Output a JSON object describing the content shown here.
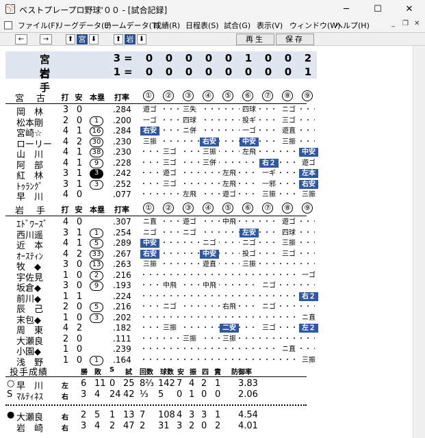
{
  "window": {
    "title": "ベストプレープロ野球'００ - [試合記録]",
    "minimize": "─",
    "maximize": "☐",
    "close": "✕"
  },
  "menu": [
    "ファイル(F)",
    "リーグデータ(L)",
    "チームデータ(T)",
    "成績(R)",
    "日程表(S)",
    "試合(G)",
    "表示(V)",
    "ウィンドウ(W)",
    "ヘルプ(H)"
  ],
  "mdi": {
    "min": "_",
    "restore": "❐",
    "close": "✕"
  },
  "toolbar": {
    "prev": "←",
    "next": "→",
    "team1_up": "⬆",
    "team1": "宮",
    "team1_down": "⬇",
    "team2_up": "⬆",
    "team2": "岩",
    "team2_down": "⬇",
    "replay": "再生",
    "save": "保存"
  },
  "scoreboard": [
    {
      "team": "宮古",
      "total": "3",
      "eq": "=",
      "innings": [
        "0",
        "0",
        "0",
        "0",
        "0",
        "1",
        "0",
        "0",
        "2"
      ]
    },
    {
      "team": "岩手",
      "total": "1",
      "eq": "=",
      "innings": [
        "0",
        "0",
        "0",
        "0",
        "0",
        "0",
        "0",
        "0",
        "1"
      ]
    }
  ],
  "headers": {
    "ab": "打",
    "hit": "安",
    "hr": "本塁",
    "avg": "打率",
    "innings": [
      "①",
      "②",
      "③",
      "④",
      "⑤",
      "⑥",
      "⑦",
      "⑧",
      "⑨"
    ]
  },
  "team1": {
    "name": "宮古",
    "players": [
      {
        "name": "岡　林",
        "ab": "3",
        "h": "0",
        "hr": "",
        "hrs": "",
        "avg": ".284",
        "pa": [
          {
            "i": 0,
            "t": "遊ゴ"
          },
          {
            "i": 2,
            "t": "三失"
          },
          {
            "i": 5,
            "t": "四球"
          },
          {
            "i": 7,
            "t": "ニゴ"
          }
        ]
      },
      {
        "name": "松本剛",
        "ab": "2",
        "h": "0",
        "hr": "1",
        "hrs": "ring",
        "avg": ".200",
        "pa": [
          {
            "i": 0,
            "t": "一ゴ"
          },
          {
            "i": 2,
            "t": "四球"
          },
          {
            "i": 5,
            "t": "投ギ"
          },
          {
            "i": 7,
            "t": "三ゴ"
          }
        ]
      },
      {
        "name": "宮崎☆",
        "ab": "4",
        "h": "1",
        "hr": "16",
        "hrs": "ring",
        "avg": ".284",
        "pa": [
          {
            "i": 0,
            "t": "右安",
            "hit": true
          },
          {
            "i": 2,
            "t": "ニ併"
          },
          {
            "i": 5,
            "t": "一ゴ"
          },
          {
            "i": 7,
            "t": "遊直"
          }
        ]
      },
      {
        "name": "ローリー",
        "ab": "4",
        "h": "2",
        "hr": "30",
        "hrs": "ring",
        "avg": ".230",
        "pa": [
          {
            "i": 0,
            "t": "三振"
          },
          {
            "i": 3,
            "t": "右安",
            "hit": true
          },
          {
            "i": 5,
            "t": "中安",
            "hit": true
          },
          {
            "i": 7,
            "t": "三振"
          }
        ]
      },
      {
        "name": "山　川",
        "ab": "4",
        "h": "1",
        "hr": "38",
        "hrs": "ring",
        "avg": ".230",
        "pa": [
          {
            "i": 1,
            "t": "三ゴ"
          },
          {
            "i": 3,
            "t": "三振"
          },
          {
            "i": 5,
            "t": "左飛"
          },
          {
            "i": 8,
            "t": "中安",
            "hit": true
          }
        ]
      },
      {
        "name": "阿　部",
        "ab": "4",
        "h": "1",
        "hr": "9",
        "hrs": "ring",
        "avg": ".228",
        "pa": [
          {
            "i": 1,
            "t": "三ゴ"
          },
          {
            "i": 3,
            "t": "三併"
          },
          {
            "i": 6,
            "t": "右２",
            "hit": true
          },
          {
            "i": 8,
            "t": "遊ゴ"
          }
        ]
      },
      {
        "name": "紅　林",
        "ab": "3",
        "h": "1",
        "hr": "3",
        "hrs": "fill",
        "avg": ".242",
        "pa": [
          {
            "i": 1,
            "t": "遊ゴ"
          },
          {
            "i": 4,
            "t": "左飛"
          },
          {
            "i": 6,
            "t": "一ギ"
          },
          {
            "i": 8,
            "t": "左本",
            "hit": true
          }
        ]
      },
      {
        "name": "ﾄｩﾗﾝｸﾞ",
        "ab": "3",
        "h": "1",
        "hr": "3",
        "hrs": "ring",
        "avg": ".252",
        "pa": [
          {
            "i": 1,
            "t": "三ゴ"
          },
          {
            "i": 4,
            "t": "左飛"
          },
          {
            "i": 6,
            "t": "一邪"
          },
          {
            "i": 8,
            "t": "右安",
            "hit": true
          }
        ]
      },
      {
        "name": "早　川",
        "ab": "4",
        "h": "0",
        "hr": "",
        "hrs": "",
        "avg": ".077",
        "pa": [
          {
            "i": 2,
            "t": "左飛"
          },
          {
            "i": 4,
            "t": "遊ゴ"
          },
          {
            "i": 6,
            "t": "三振"
          },
          {
            "i": 8,
            "t": "三振"
          }
        ]
      }
    ]
  },
  "team2": {
    "name": "岩手",
    "players": [
      {
        "name": "ｴﾄﾞﾜｰｽﾞ",
        "ab": "4",
        "h": "0",
        "hr": "",
        "hrs": "",
        "avg": ".307",
        "pa": [
          {
            "i": 0,
            "t": "ニ直"
          },
          {
            "i": 2,
            "t": "遊ゴ"
          },
          {
            "i": 4,
            "t": "中飛"
          },
          {
            "i": 7,
            "t": "遊ゴ"
          }
        ]
      },
      {
        "name": "西川遥",
        "ab": "3",
        "h": "1",
        "hr": "1",
        "hrs": "ring",
        "avg": ".254",
        "pa": [
          {
            "i": 0,
            "t": "ニゴ"
          },
          {
            "i": 2,
            "t": "ニゴ"
          },
          {
            "i": 5,
            "t": "左安",
            "hit": true
          },
          {
            "i": 7,
            "t": "四球"
          }
        ]
      },
      {
        "name": "近　本",
        "ab": "4",
        "h": "1",
        "hr": "5",
        "hrs": "ring",
        "avg": ".289",
        "pa": [
          {
            "i": 0,
            "t": "中安",
            "hit": true
          },
          {
            "i": 3,
            "t": "ニゴ"
          },
          {
            "i": 5,
            "t": "ニゴ"
          },
          {
            "i": 7,
            "t": "三振"
          }
        ]
      },
      {
        "name": "ｵｰｽﾃｨﾝ",
        "ab": "4",
        "h": "2",
        "hr": "33",
        "hrs": "ring",
        "avg": ".267",
        "pa": [
          {
            "i": 0,
            "t": "右安",
            "hit": true
          },
          {
            "i": 3,
            "t": "中安",
            "hit": true
          },
          {
            "i": 5,
            "t": "投ゴ"
          },
          {
            "i": 7,
            "t": "三ゴ"
          }
        ]
      },
      {
        "name": "牧　◆",
        "ab": "3",
        "h": "0",
        "hr": "13",
        "hrs": "ring",
        "avg": ".263",
        "pa": [
          {
            "i": 0,
            "t": "三振"
          },
          {
            "i": 3,
            "t": "遊直"
          },
          {
            "i": 5,
            "t": "三振"
          }
        ]
      },
      {
        "name": "宇佐見",
        "ab": "1",
        "h": "0",
        "hr": "2",
        "hrs": "ring",
        "avg": ".216",
        "pa": [
          {
            "i": 8,
            "t": "一ゴ"
          }
        ]
      },
      {
        "name": "坂倉◆",
        "ab": "3",
        "h": "0",
        "hr": "9",
        "hrs": "ring",
        "avg": ".193",
        "pa": [
          {
            "i": 1,
            "t": "中飛"
          },
          {
            "i": 3,
            "t": "中飛"
          },
          {
            "i": 6,
            "t": "ニゴ"
          }
        ]
      },
      {
        "name": "前川◆",
        "ab": "1",
        "h": "1",
        "hr": "",
        "hrs": "",
        "avg": ".224",
        "pa": [
          {
            "i": 8,
            "t": "右２",
            "hit": true
          }
        ]
      },
      {
        "name": "辰　己",
        "ab": "2",
        "h": "0",
        "hr": "5",
        "hrs": "ring",
        "avg": ".216",
        "pa": [
          {
            "i": 1,
            "t": "ニゴ"
          },
          {
            "i": 4,
            "t": "右飛"
          },
          {
            "i": 6,
            "t": "ニゴ"
          }
        ]
      },
      {
        "name": "末包◆",
        "ab": "1",
        "h": "0",
        "hr": "3",
        "hrs": "ring",
        "avg": ".202",
        "pa": [
          {
            "i": 8,
            "t": "ニ直"
          }
        ]
      },
      {
        "name": "周　東",
        "ab": "4",
        "h": "2",
        "hr": "",
        "hrs": "",
        "avg": ".182",
        "pa": [
          {
            "i": 1,
            "t": "三振"
          },
          {
            "i": 4,
            "t": "二安",
            "hit": true
          },
          {
            "i": 6,
            "t": "三ゴ"
          },
          {
            "i": 8,
            "t": "左２",
            "hit": true
          }
        ]
      },
      {
        "name": "大瀬良",
        "ab": "2",
        "h": "0",
        "hr": "",
        "hrs": "",
        "avg": ".111",
        "pa": [
          {
            "i": 2,
            "t": "三振"
          },
          {
            "i": 4,
            "t": "三振"
          }
        ]
      },
      {
        "name": "小園◆",
        "ab": "1",
        "h": "0",
        "hr": "",
        "hrs": "",
        "avg": ".239",
        "pa": [
          {
            "i": 7,
            "t": "ニ直"
          }
        ]
      },
      {
        "name": "浅　野",
        "ab": "1",
        "h": "0",
        "hr": "1",
        "hrs": "ring",
        "avg": ".164",
        "pa": [
          {
            "i": 8,
            "t": "三振"
          }
        ]
      }
    ]
  },
  "pitching": {
    "title": "投手成績",
    "headers": [
      "勝",
      "敗",
      "S",
      "試",
      "回数",
      "球数",
      "安",
      "振",
      "四",
      "責",
      "防御率"
    ],
    "rows": [
      {
        "mark": "○",
        "name": "早　川",
        "hand": "左",
        "vals": [
          "6",
          "11",
          "0",
          "25",
          "8⅔",
          "142",
          "7",
          "4",
          "2",
          "1",
          "3.83"
        ]
      },
      {
        "mark": "S",
        "name": "ﾏﾙﾃｨﾈｽ",
        "hand": "右",
        "vals": [
          "3",
          "4",
          "24",
          "42",
          "⅓",
          "5",
          "0",
          "1",
          "0",
          "0",
          "2.06"
        ]
      },
      {
        "mark": "●",
        "name": "大瀬良",
        "hand": "右",
        "vals": [
          "2",
          "5",
          "1",
          "13",
          "7",
          "108",
          "4",
          "3",
          "3",
          "1",
          "4.54"
        ]
      },
      {
        "mark": "",
        "name": "岩　崎",
        "hand": "右",
        "vals": [
          "3",
          "4",
          "2",
          "47",
          "2",
          "31",
          "3",
          "2",
          "0",
          "2",
          "4.01"
        ]
      }
    ]
  }
}
